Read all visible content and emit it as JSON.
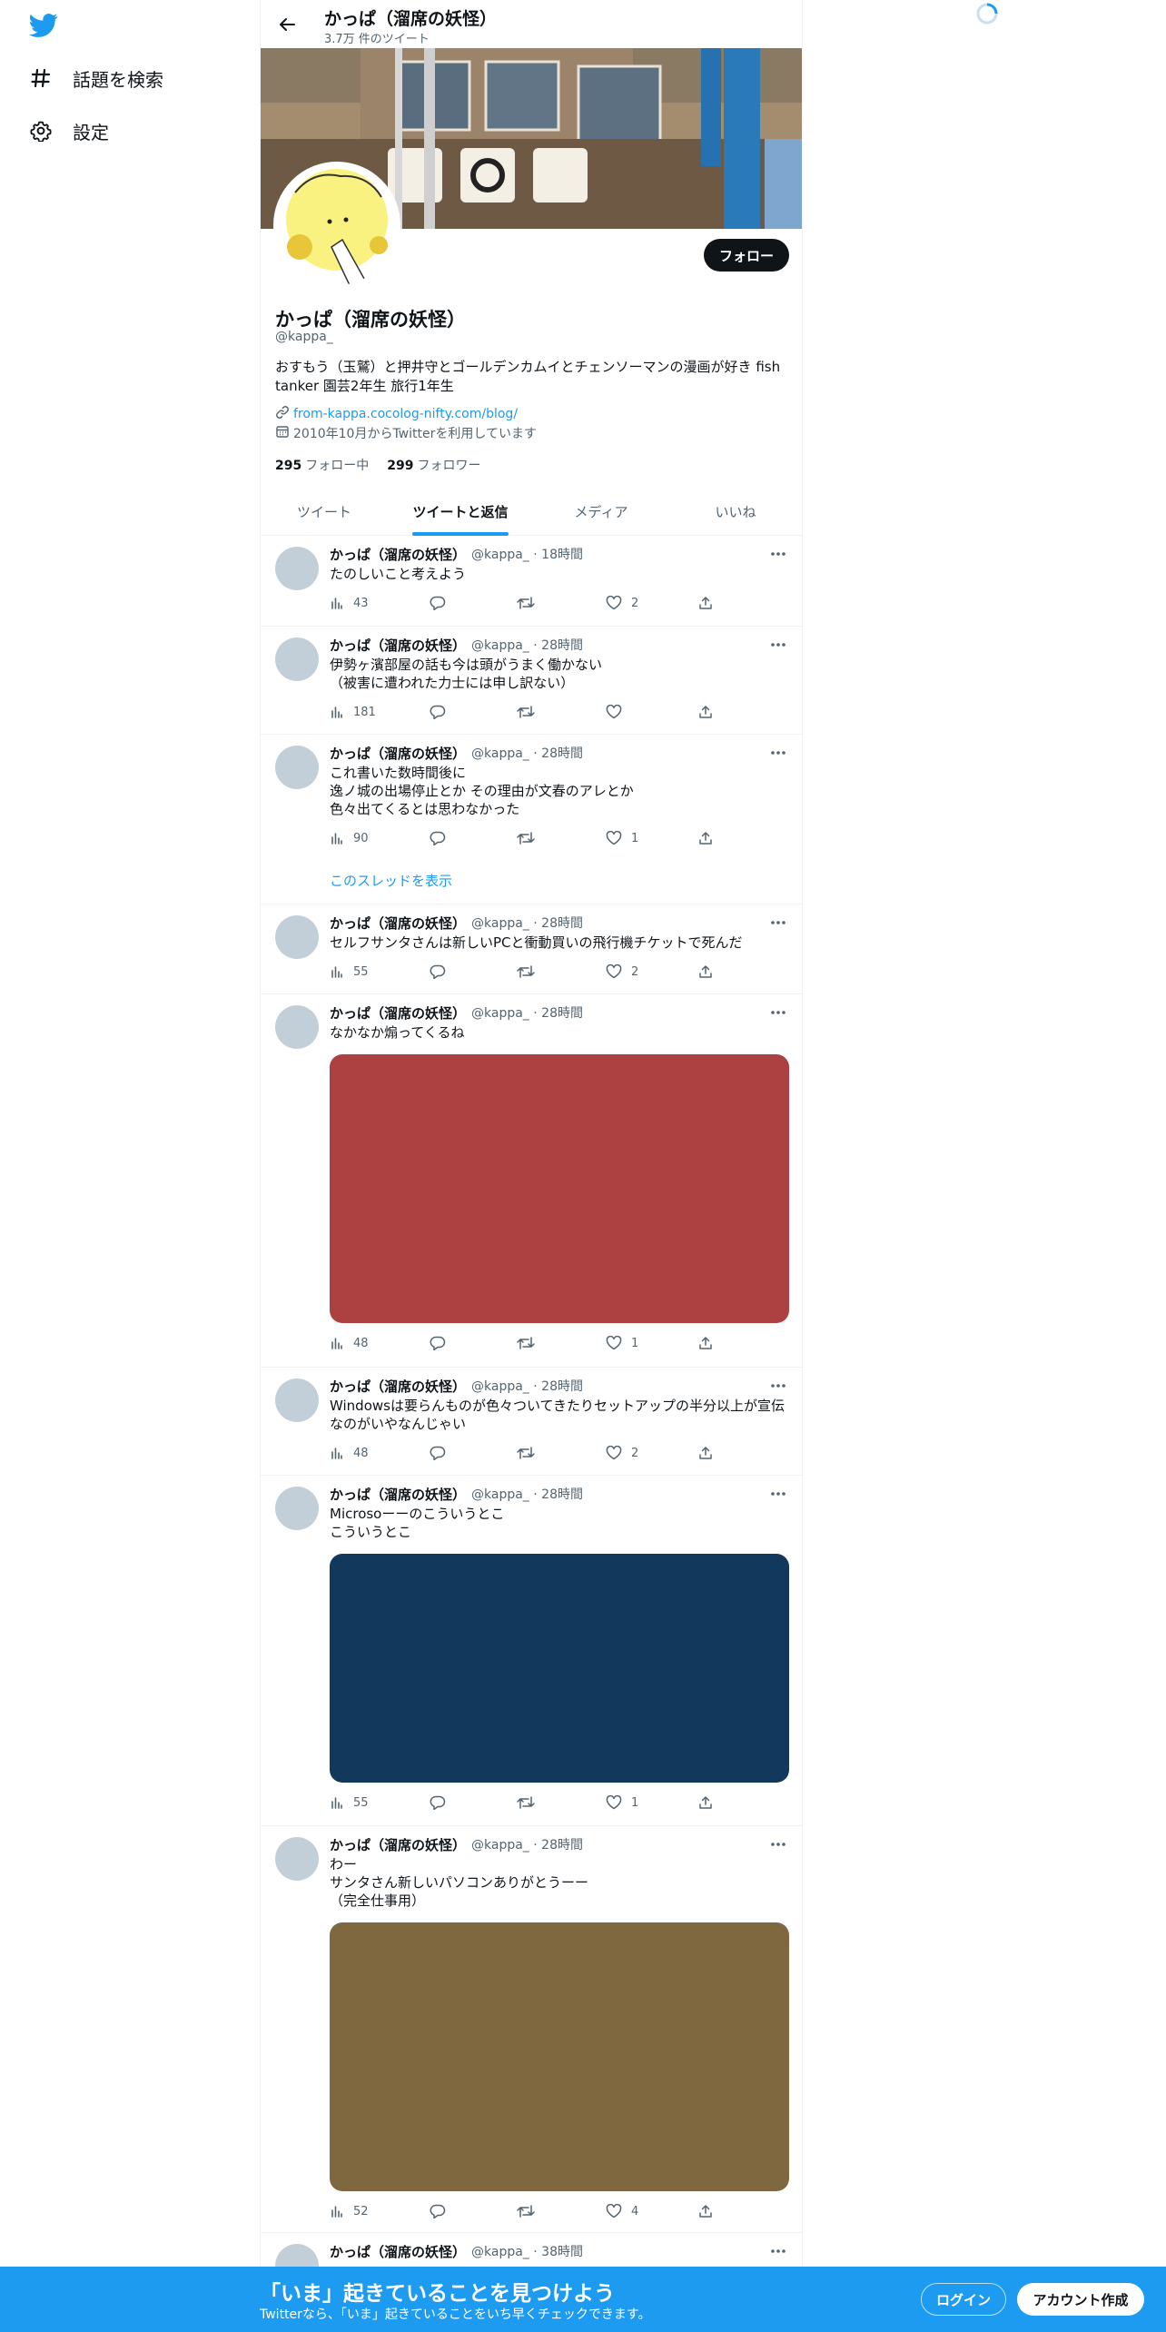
{
  "nav": {
    "logo_icon": "twitter-bird-icon",
    "items": [
      {
        "icon": "hashtag-icon",
        "label": "話題を検索"
      },
      {
        "icon": "gear-icon",
        "label": "設定"
      }
    ]
  },
  "header": {
    "title": "かっぱ（溜席の妖怪）",
    "subtitle": "3.7万 件のツイート"
  },
  "profile": {
    "follow_label": "フォロー",
    "name": "かっぱ（溜席の妖怪）",
    "handle": "@kappa_",
    "bio": "おすもう（玉鷲）と押井守とゴールデンカムイとチェンソーマンの漫画が好き fish tanker 園芸2年生 旅行1年生",
    "url": "from-kappa.cocolog-nifty.com/blog/",
    "joined": "2010年10月からTwitterを利用しています",
    "following_count": "295",
    "following_label": "フォロー中",
    "followers_count": "299",
    "followers_label": "フォロワー"
  },
  "tabs": [
    {
      "label": "ツイート",
      "active": false
    },
    {
      "label": "ツイートと返信",
      "active": true
    },
    {
      "label": "メディア",
      "active": false
    },
    {
      "label": "いいね",
      "active": false
    }
  ],
  "tweets": [
    {
      "name": "かっぱ（溜席の妖怪）",
      "meta": "@kappa_ · 18時間",
      "lines": [
        "たのしいこと考えよう"
      ],
      "views": "43",
      "likes": "2"
    },
    {
      "name": "かっぱ（溜席の妖怪）",
      "meta": "@kappa_ · 28時間",
      "lines": [
        "伊勢ヶ濱部屋の話も今は頭がうまく働かない",
        "（被害に遭われた力士には申し訳ない）"
      ],
      "views": "181",
      "likes": ""
    },
    {
      "name": "かっぱ（溜席の妖怪）",
      "meta": "@kappa_ · 28時間",
      "lines": [
        "これ書いた数時間後に",
        "逸ノ城の出場停止とか その理由が文春のアレとか",
        "色々出てくるとは思わなかった"
      ],
      "views": "90",
      "likes": "1",
      "thread_link": "このスレッドを表示"
    },
    {
      "name": "かっぱ（溜席の妖怪）",
      "meta": "@kappa_ · 28時間",
      "lines": [
        "セルフサンタさんは新しいPCと衝動買いの飛行機チケットで死んだ"
      ],
      "views": "55",
      "likes": "2"
    },
    {
      "name": "かっぱ（溜席の妖怪）",
      "meta": "@kappa_ · 28時間",
      "lines": [
        "なかなか煽ってくるね"
      ],
      "views": "48",
      "likes": "1",
      "media_color": "#ad4040"
    },
    {
      "name": "かっぱ（溜席の妖怪）",
      "meta": "@kappa_ · 28時間",
      "lines": [
        "Windowsは要らんものが色々ついてきたりセットアップの半分以上が宣伝",
        "なのがいやなんじゃい"
      ],
      "views": "48",
      "likes": "2"
    },
    {
      "name": "かっぱ（溜席の妖怪）",
      "meta": "@kappa_ · 28時間",
      "lines": [
        "Microsoーーのこういうとこ",
        "こういうとこ"
      ],
      "views": "55",
      "likes": "1",
      "media_color": "#12385c"
    },
    {
      "name": "かっぱ（溜席の妖怪）",
      "meta": "@kappa_ · 28時間",
      "lines": [
        "わー",
        "サンタさん新しいパソコンありがとうーー",
        "（完全仕事用）"
      ],
      "views": "52",
      "likes": "4",
      "media_color": "#7f6840"
    },
    {
      "name": "かっぱ（溜席の妖怪）",
      "meta": "@kappa_ · 38時間",
      "lines": [],
      "views": "",
      "likes": ""
    }
  ],
  "bottom_bar": {
    "title": "「いま」起きていることを見つけよう",
    "subtitle": "Twitterなら、「いま」起きていることをいち早くチェックできます。",
    "login_label": "ログイン",
    "signup_label": "アカウント作成"
  },
  "colors": {
    "accent": "#1d9bf0",
    "text": "#0f1419",
    "muted": "#536471"
  }
}
